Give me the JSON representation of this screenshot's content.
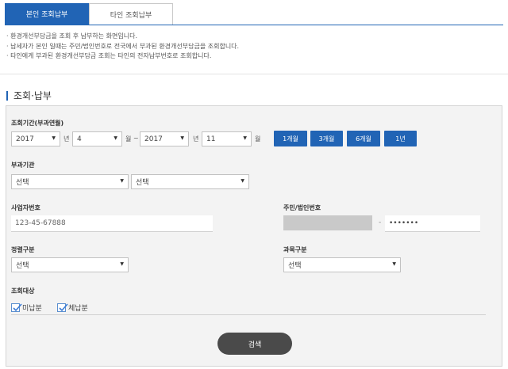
{
  "tabs": [
    {
      "label": "본인 조회납부",
      "active": true
    },
    {
      "label": "타인 조회납부",
      "active": false
    }
  ],
  "notes": [
    "· 환경개선부담금을 조회 후 납부하는 화면입니다.",
    "· 납세자가 본인 일때는 주민/법인번호로 전국에서 부과된 환경개선부담금을 조회합니다.",
    "· 타인에게 부과된 환경개선부담금 조회는 타인의 전자납부번호로 조회합니다."
  ],
  "section_title": "조회·납부",
  "period": {
    "label": "조회기간(부과연월)",
    "from_year": "2017",
    "from_month": "4",
    "to_year": "2017",
    "to_month": "11",
    "year_unit": "년",
    "month_unit": "월",
    "tilde": "~",
    "quick_buttons": [
      "1개월",
      "3개월",
      "6개월",
      "1년"
    ]
  },
  "agency": {
    "label": "부과기관",
    "select1": "선택",
    "select2": "선택"
  },
  "business_no": {
    "label": "사업자번호",
    "value": "123-45-67888"
  },
  "resident_no": {
    "label": "주민/법인번호",
    "dash": "-",
    "back_masked": "•••••••"
  },
  "fine_type": {
    "label": "정렬구분",
    "value": "선택"
  },
  "tax_type": {
    "label": "과목구분",
    "value": "선택"
  },
  "target": {
    "label": "조회대상",
    "options": [
      {
        "label": "미납분",
        "checked": true
      },
      {
        "label": "체납분",
        "checked": true
      }
    ]
  },
  "search_label": "검색",
  "colors": {
    "accent": "#2164b5",
    "panel_bg": "#f3f3f3",
    "search_btn": "#4a4a4a"
  }
}
